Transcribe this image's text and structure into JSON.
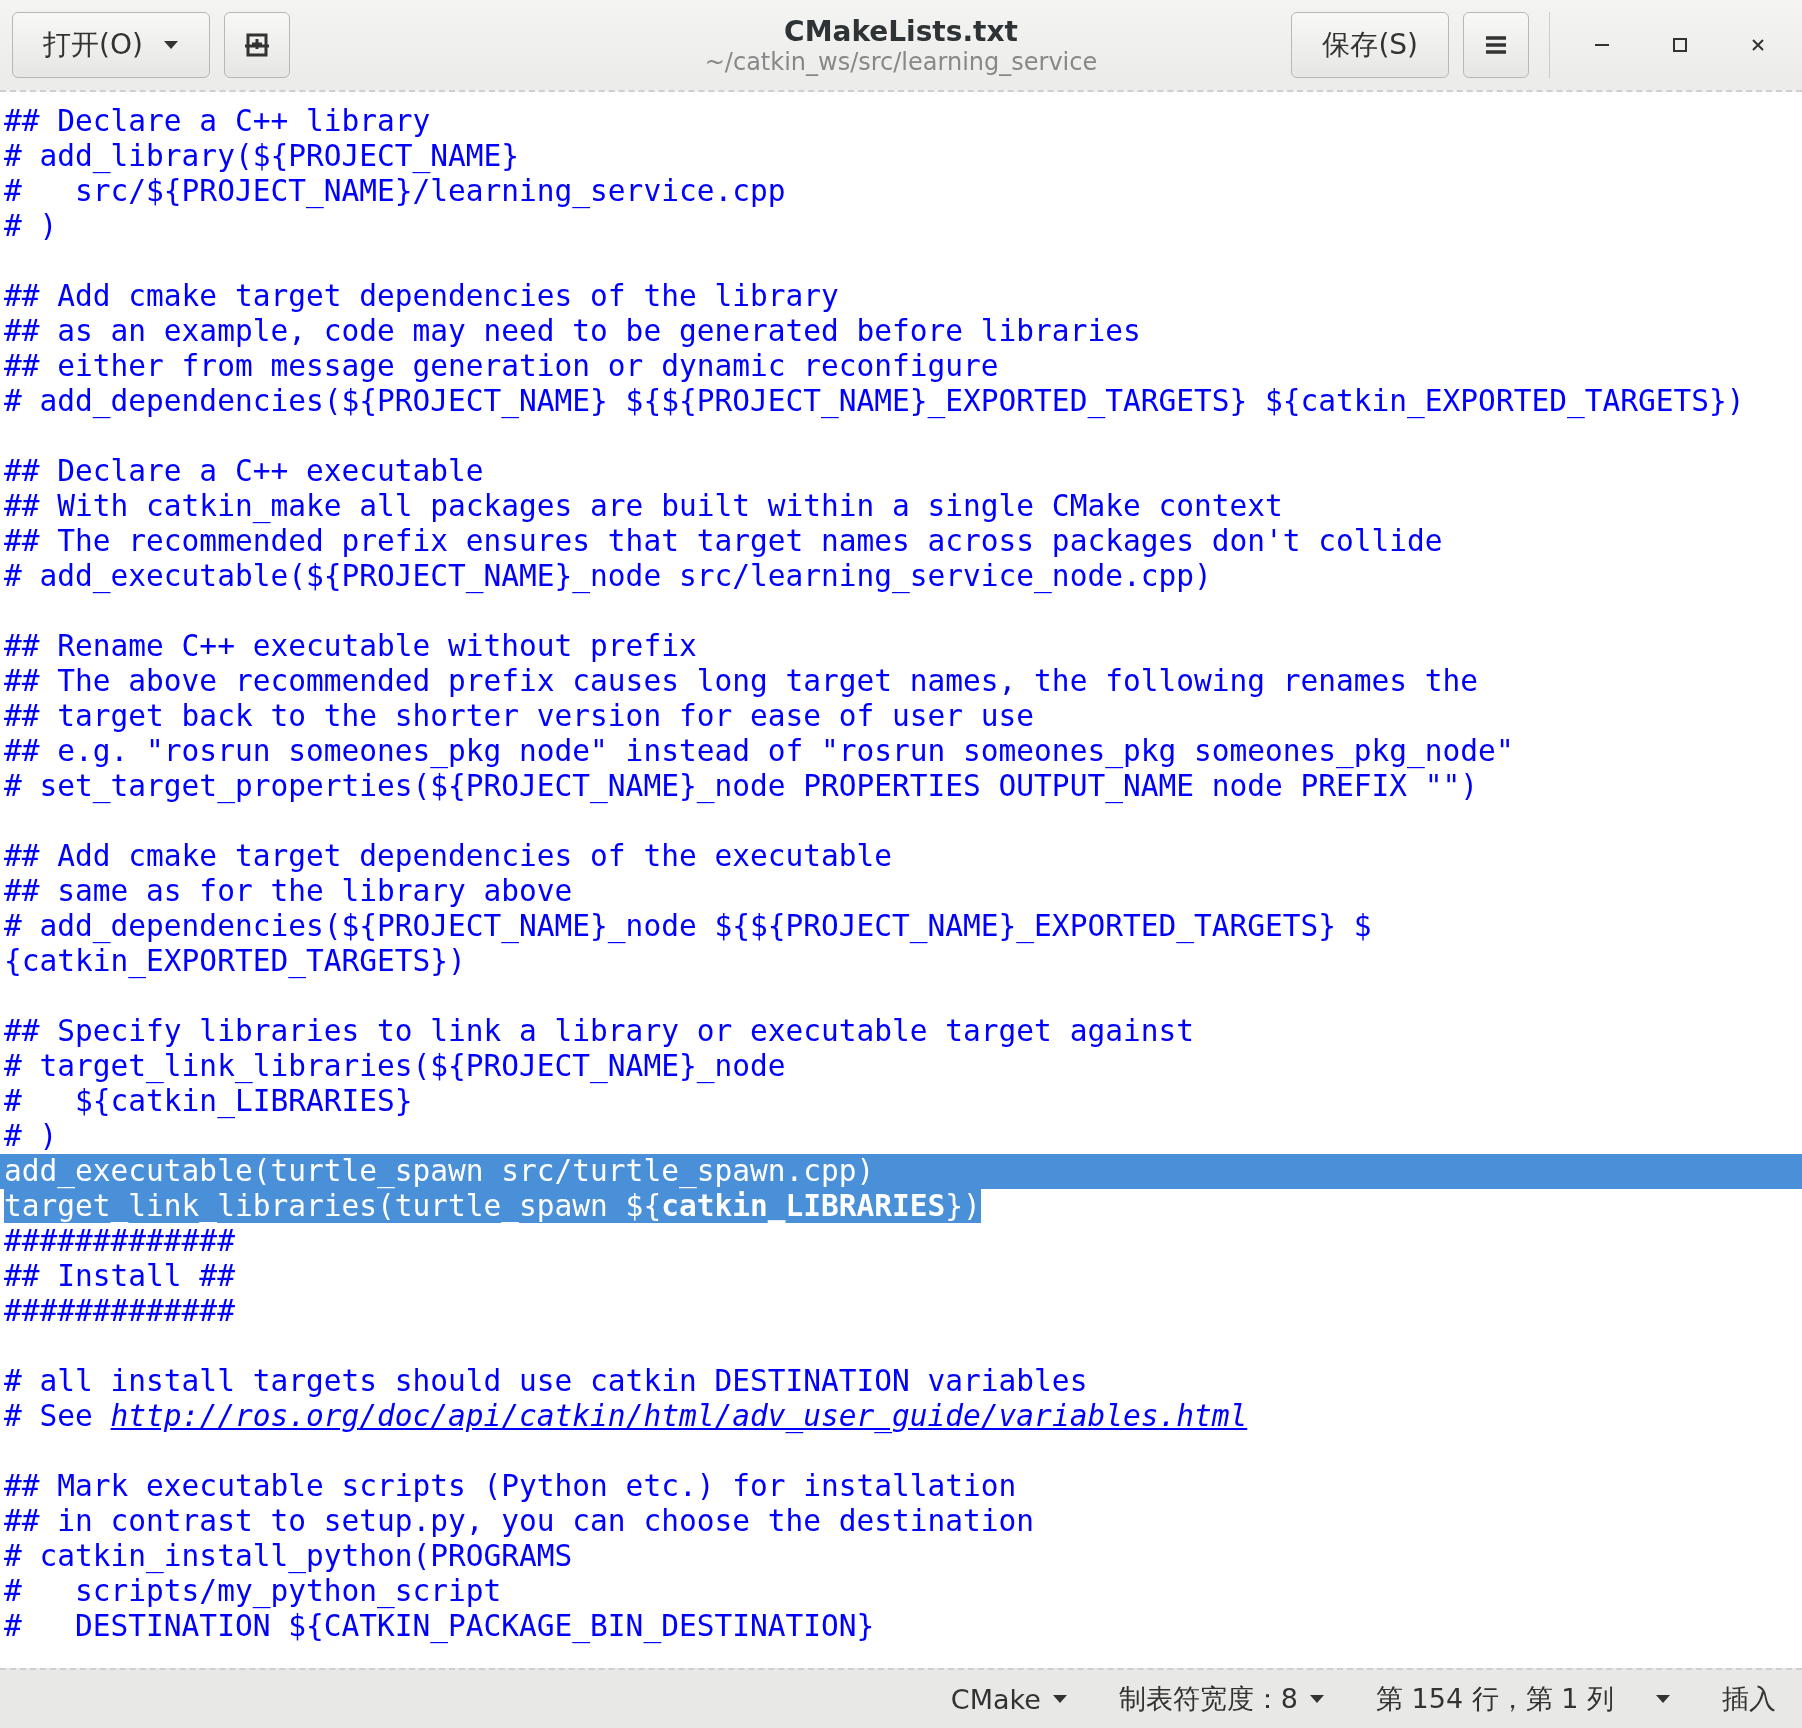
{
  "header": {
    "open_button": "打开(O)",
    "title": "CMakeLists.txt",
    "subtitle": "~/catkin_ws/src/learning_service",
    "save_button": "保存(S)"
  },
  "lines": [
    {
      "kind": "comment",
      "text": "## Declare a C++ library",
      "selected": false
    },
    {
      "kind": "comment",
      "text": "# add_library(${PROJECT_NAME}",
      "selected": false
    },
    {
      "kind": "comment",
      "text": "#   src/${PROJECT_NAME}/learning_service.cpp",
      "selected": false
    },
    {
      "kind": "comment",
      "text": "# )",
      "selected": false
    },
    {
      "kind": "blank"
    },
    {
      "kind": "comment",
      "text": "## Add cmake target dependencies of the library",
      "selected": false
    },
    {
      "kind": "comment",
      "text": "## as an example, code may need to be generated before libraries",
      "selected": false
    },
    {
      "kind": "comment",
      "text": "## either from message generation or dynamic reconfigure",
      "selected": false
    },
    {
      "kind": "comment",
      "text": "# add_dependencies(${PROJECT_NAME} ${${PROJECT_NAME}_EXPORTED_TARGETS} ${catkin_EXPORTED_TARGETS})",
      "selected": false
    },
    {
      "kind": "blank"
    },
    {
      "kind": "comment",
      "text": "## Declare a C++ executable",
      "selected": false
    },
    {
      "kind": "comment",
      "text": "## With catkin_make all packages are built within a single CMake context",
      "selected": false
    },
    {
      "kind": "comment",
      "text": "## The recommended prefix ensures that target names across packages don't collide",
      "selected": false
    },
    {
      "kind": "comment",
      "text": "# add_executable(${PROJECT_NAME}_node src/learning_service_node.cpp)",
      "selected": false
    },
    {
      "kind": "blank"
    },
    {
      "kind": "comment",
      "text": "## Rename C++ executable without prefix",
      "selected": false
    },
    {
      "kind": "comment",
      "text": "## The above recommended prefix causes long target names, the following renames the",
      "selected": false
    },
    {
      "kind": "comment",
      "text": "## target back to the shorter version for ease of user use",
      "selected": false
    },
    {
      "kind": "comment",
      "text": "## e.g. \"rosrun someones_pkg node\" instead of \"rosrun someones_pkg someones_pkg_node\"",
      "selected": false
    },
    {
      "kind": "comment",
      "text": "# set_target_properties(${PROJECT_NAME}_node PROPERTIES OUTPUT_NAME node PREFIX \"\")",
      "selected": false
    },
    {
      "kind": "blank"
    },
    {
      "kind": "comment",
      "text": "## Add cmake target dependencies of the executable",
      "selected": false
    },
    {
      "kind": "comment",
      "text": "## same as for the library above",
      "selected": false
    },
    {
      "kind": "comment",
      "text": "# add_dependencies(${PROJECT_NAME}_node ${${PROJECT_NAME}_EXPORTED_TARGETS} $",
      "selected": false
    },
    {
      "kind": "comment",
      "text": "{catkin_EXPORTED_TARGETS})",
      "selected": false
    },
    {
      "kind": "blank"
    },
    {
      "kind": "comment",
      "text": "## Specify libraries to link a library or executable target against",
      "selected": false
    },
    {
      "kind": "comment",
      "text": "# target_link_libraries(${PROJECT_NAME}_node",
      "selected": false
    },
    {
      "kind": "comment",
      "text": "#   ${catkin_LIBRARIES}",
      "selected": false
    },
    {
      "kind": "comment",
      "text": "# )",
      "selected": false
    },
    {
      "kind": "code",
      "text": "add_executable(turtle_spawn src/turtle_spawn.cpp)",
      "selected": true,
      "selection_to_edge": true
    },
    {
      "kind": "code",
      "text": "target_link_libraries(turtle_spawn ${**catkin_LIBRARIES**})",
      "selected": true,
      "selection_to_edge": false
    },
    {
      "kind": "comment",
      "text": "#############",
      "selected": false
    },
    {
      "kind": "comment",
      "text": "## Install ##",
      "selected": false
    },
    {
      "kind": "comment",
      "text": "#############",
      "selected": false
    },
    {
      "kind": "blank"
    },
    {
      "kind": "comment",
      "text": "# all install targets should use catkin DESTINATION variables",
      "selected": false
    },
    {
      "kind": "link",
      "text": "# See ",
      "link": "http://ros.org/doc/api/catkin/html/adv_user_guide/variables.html",
      "selected": false
    },
    {
      "kind": "blank"
    },
    {
      "kind": "comment",
      "text": "## Mark executable scripts (Python etc.) for installation",
      "selected": false
    },
    {
      "kind": "comment",
      "text": "## in contrast to setup.py, you can choose the destination",
      "selected": false
    },
    {
      "kind": "comment",
      "text": "# catkin_install_python(PROGRAMS",
      "selected": false
    },
    {
      "kind": "comment",
      "text": "#   scripts/my_python_script",
      "selected": false
    },
    {
      "kind": "comment",
      "text": "#   DESTINATION ${CATKIN_PACKAGE_BIN_DESTINATION}",
      "selected": false
    }
  ],
  "status_bar": {
    "language": "CMake",
    "tab_width": "制表符宽度：8",
    "position": "第 154 行，第 1 列",
    "mode": "插入"
  }
}
